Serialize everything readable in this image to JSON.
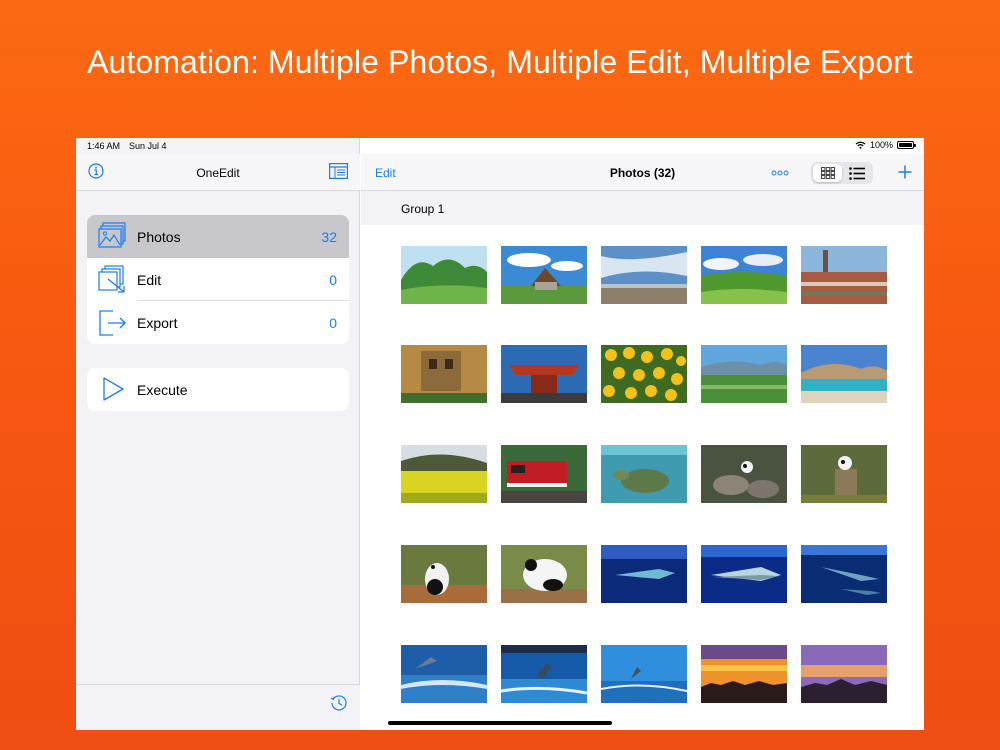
{
  "headline": "Automation: Multiple Photos, Multiple Edit, Multiple Export",
  "status_bar": {
    "time": "1:46 AM",
    "date": "Sun Jul 4",
    "battery": "100%"
  },
  "sidebar": {
    "title": "OneEdit",
    "items": [
      {
        "label": "Photos",
        "count": "32",
        "icon": "photos-icon",
        "selected": true
      },
      {
        "label": "Edit",
        "count": "0",
        "icon": "edit-icon",
        "selected": false
      },
      {
        "label": "Export",
        "count": "0",
        "icon": "export-icon",
        "selected": false
      }
    ],
    "execute": {
      "label": "Execute",
      "icon": "play-icon"
    }
  },
  "main": {
    "edit_label": "Edit",
    "title": "Photos (32)",
    "group_label": "Group 1",
    "view_mode": "grid"
  },
  "colors": {
    "accent": "#1b7cf2",
    "background": "#f75511",
    "selected_row": "#c7c7cc"
  },
  "photos": [
    "green-hills",
    "thatched-farmhouse",
    "beach-sky",
    "meadow-clouds",
    "old-town-rooftops",
    "stone-canyon-building",
    "red-pavilion",
    "sunflowers",
    "valley-aerial",
    "turquoise-lake",
    "rapeseed-field",
    "red-locomotive",
    "sea-turtle",
    "panda-enclosure",
    "panda-on-log",
    "panda-walking",
    "panda-lying",
    "whale-shark",
    "fish-blue",
    "aquarium-fish",
    "dolphins-jumping",
    "dolphin-pool",
    "dolphin-show",
    "sunset-orange",
    "sunset-purple"
  ]
}
